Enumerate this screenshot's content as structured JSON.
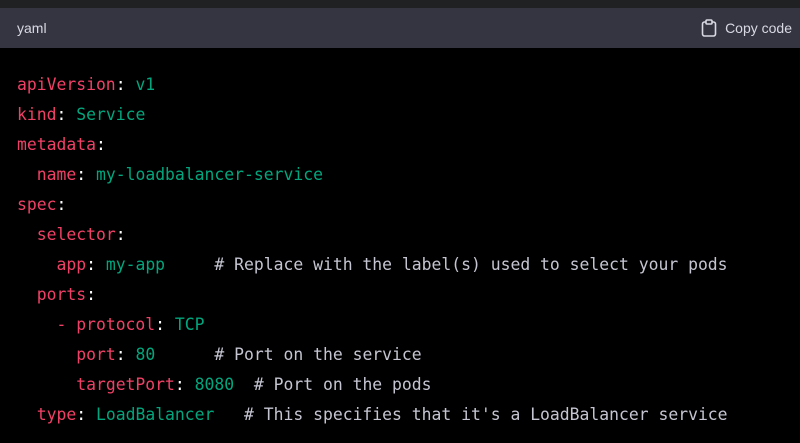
{
  "header": {
    "language": "yaml",
    "copy_label": "Copy code",
    "copy_icon": "clipboard-icon"
  },
  "colors": {
    "key": "#ef4166",
    "value": "#00a67d",
    "comment": "#c5c5d2",
    "header_bg": "#343541",
    "code_bg": "#000000"
  },
  "code": {
    "lines": [
      {
        "indent": "",
        "key": "apiVersion",
        "value": "v1",
        "pad": "",
        "comment": ""
      },
      {
        "indent": "",
        "key": "kind",
        "value": "Service",
        "pad": "",
        "comment": ""
      },
      {
        "indent": "",
        "key": "metadata",
        "value": "",
        "pad": "",
        "comment": ""
      },
      {
        "indent": "  ",
        "key": "name",
        "value": "my-loadbalancer-service",
        "pad": "",
        "comment": ""
      },
      {
        "indent": "",
        "key": "spec",
        "value": "",
        "pad": "",
        "comment": ""
      },
      {
        "indent": "  ",
        "key": "selector",
        "value": "",
        "pad": "",
        "comment": ""
      },
      {
        "indent": "    ",
        "key": "app",
        "value": "my-app",
        "pad": "     ",
        "comment": "# Replace with the label(s) used to select your pods"
      },
      {
        "indent": "  ",
        "key": "ports",
        "value": "",
        "pad": "",
        "comment": ""
      },
      {
        "indent": "    ",
        "key": "- protocol",
        "value": "TCP",
        "pad": "",
        "comment": ""
      },
      {
        "indent": "      ",
        "key": "port",
        "value": "80",
        "pad": "      ",
        "comment": "# Port on the service"
      },
      {
        "indent": "      ",
        "key": "targetPort",
        "value": "8080",
        "pad": "  ",
        "comment": "# Port on the pods"
      },
      {
        "indent": "  ",
        "key": "type",
        "value": "LoadBalancer",
        "pad": "   ",
        "comment": "# This specifies that it's a LoadBalancer service"
      }
    ]
  }
}
